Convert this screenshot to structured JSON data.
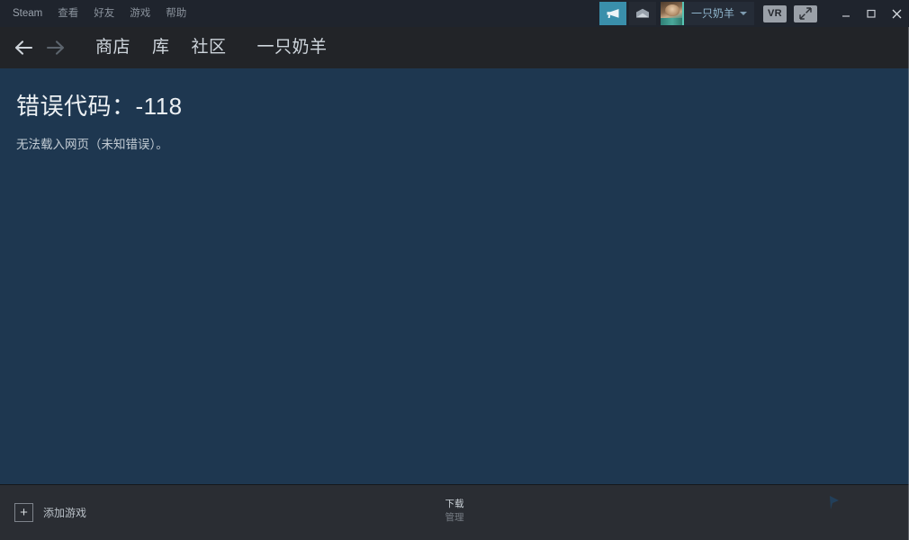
{
  "window": {
    "app_name": "Steam",
    "background_color": "#1e3750",
    "titlebar_color": "#1f242d",
    "navbar_color": "#222428",
    "bottombar_color": "#2a2d33",
    "accent_color": "#3a8fab"
  },
  "menubar": {
    "items": [
      {
        "label": "Steam"
      },
      {
        "label": "查看"
      },
      {
        "label": "好友"
      },
      {
        "label": "游戏"
      },
      {
        "label": "帮助"
      }
    ]
  },
  "titlebar_right": {
    "broadcast_icon": "broadcast-megaphone-icon",
    "mail_icon": "mail-envelope-icon",
    "avatar_icon": "user-avatar",
    "username": "一只奶羊",
    "dropdown_icon": "chevron-down-icon",
    "vr_label": "VR",
    "expand_icon": "expand-diagonal-icon",
    "minimize_label": "—",
    "maximize_label": "▢",
    "close_label": "✕"
  },
  "navbar": {
    "back_icon": "arrow-left-icon",
    "forward_icon": "arrow-right-icon",
    "links": [
      {
        "label": "商店"
      },
      {
        "label": "库"
      },
      {
        "label": "社区"
      },
      {
        "label": "一只奶羊"
      }
    ]
  },
  "content": {
    "error_title": "错误代码：-118",
    "error_message": "无法载入网页（未知错误）。"
  },
  "bottombar": {
    "add_game_icon": "plus-icon",
    "add_game_label": "添加游戏",
    "downloads_label": "下载",
    "manage_label": "管理",
    "friends_icon": "friends-chat-icon"
  }
}
